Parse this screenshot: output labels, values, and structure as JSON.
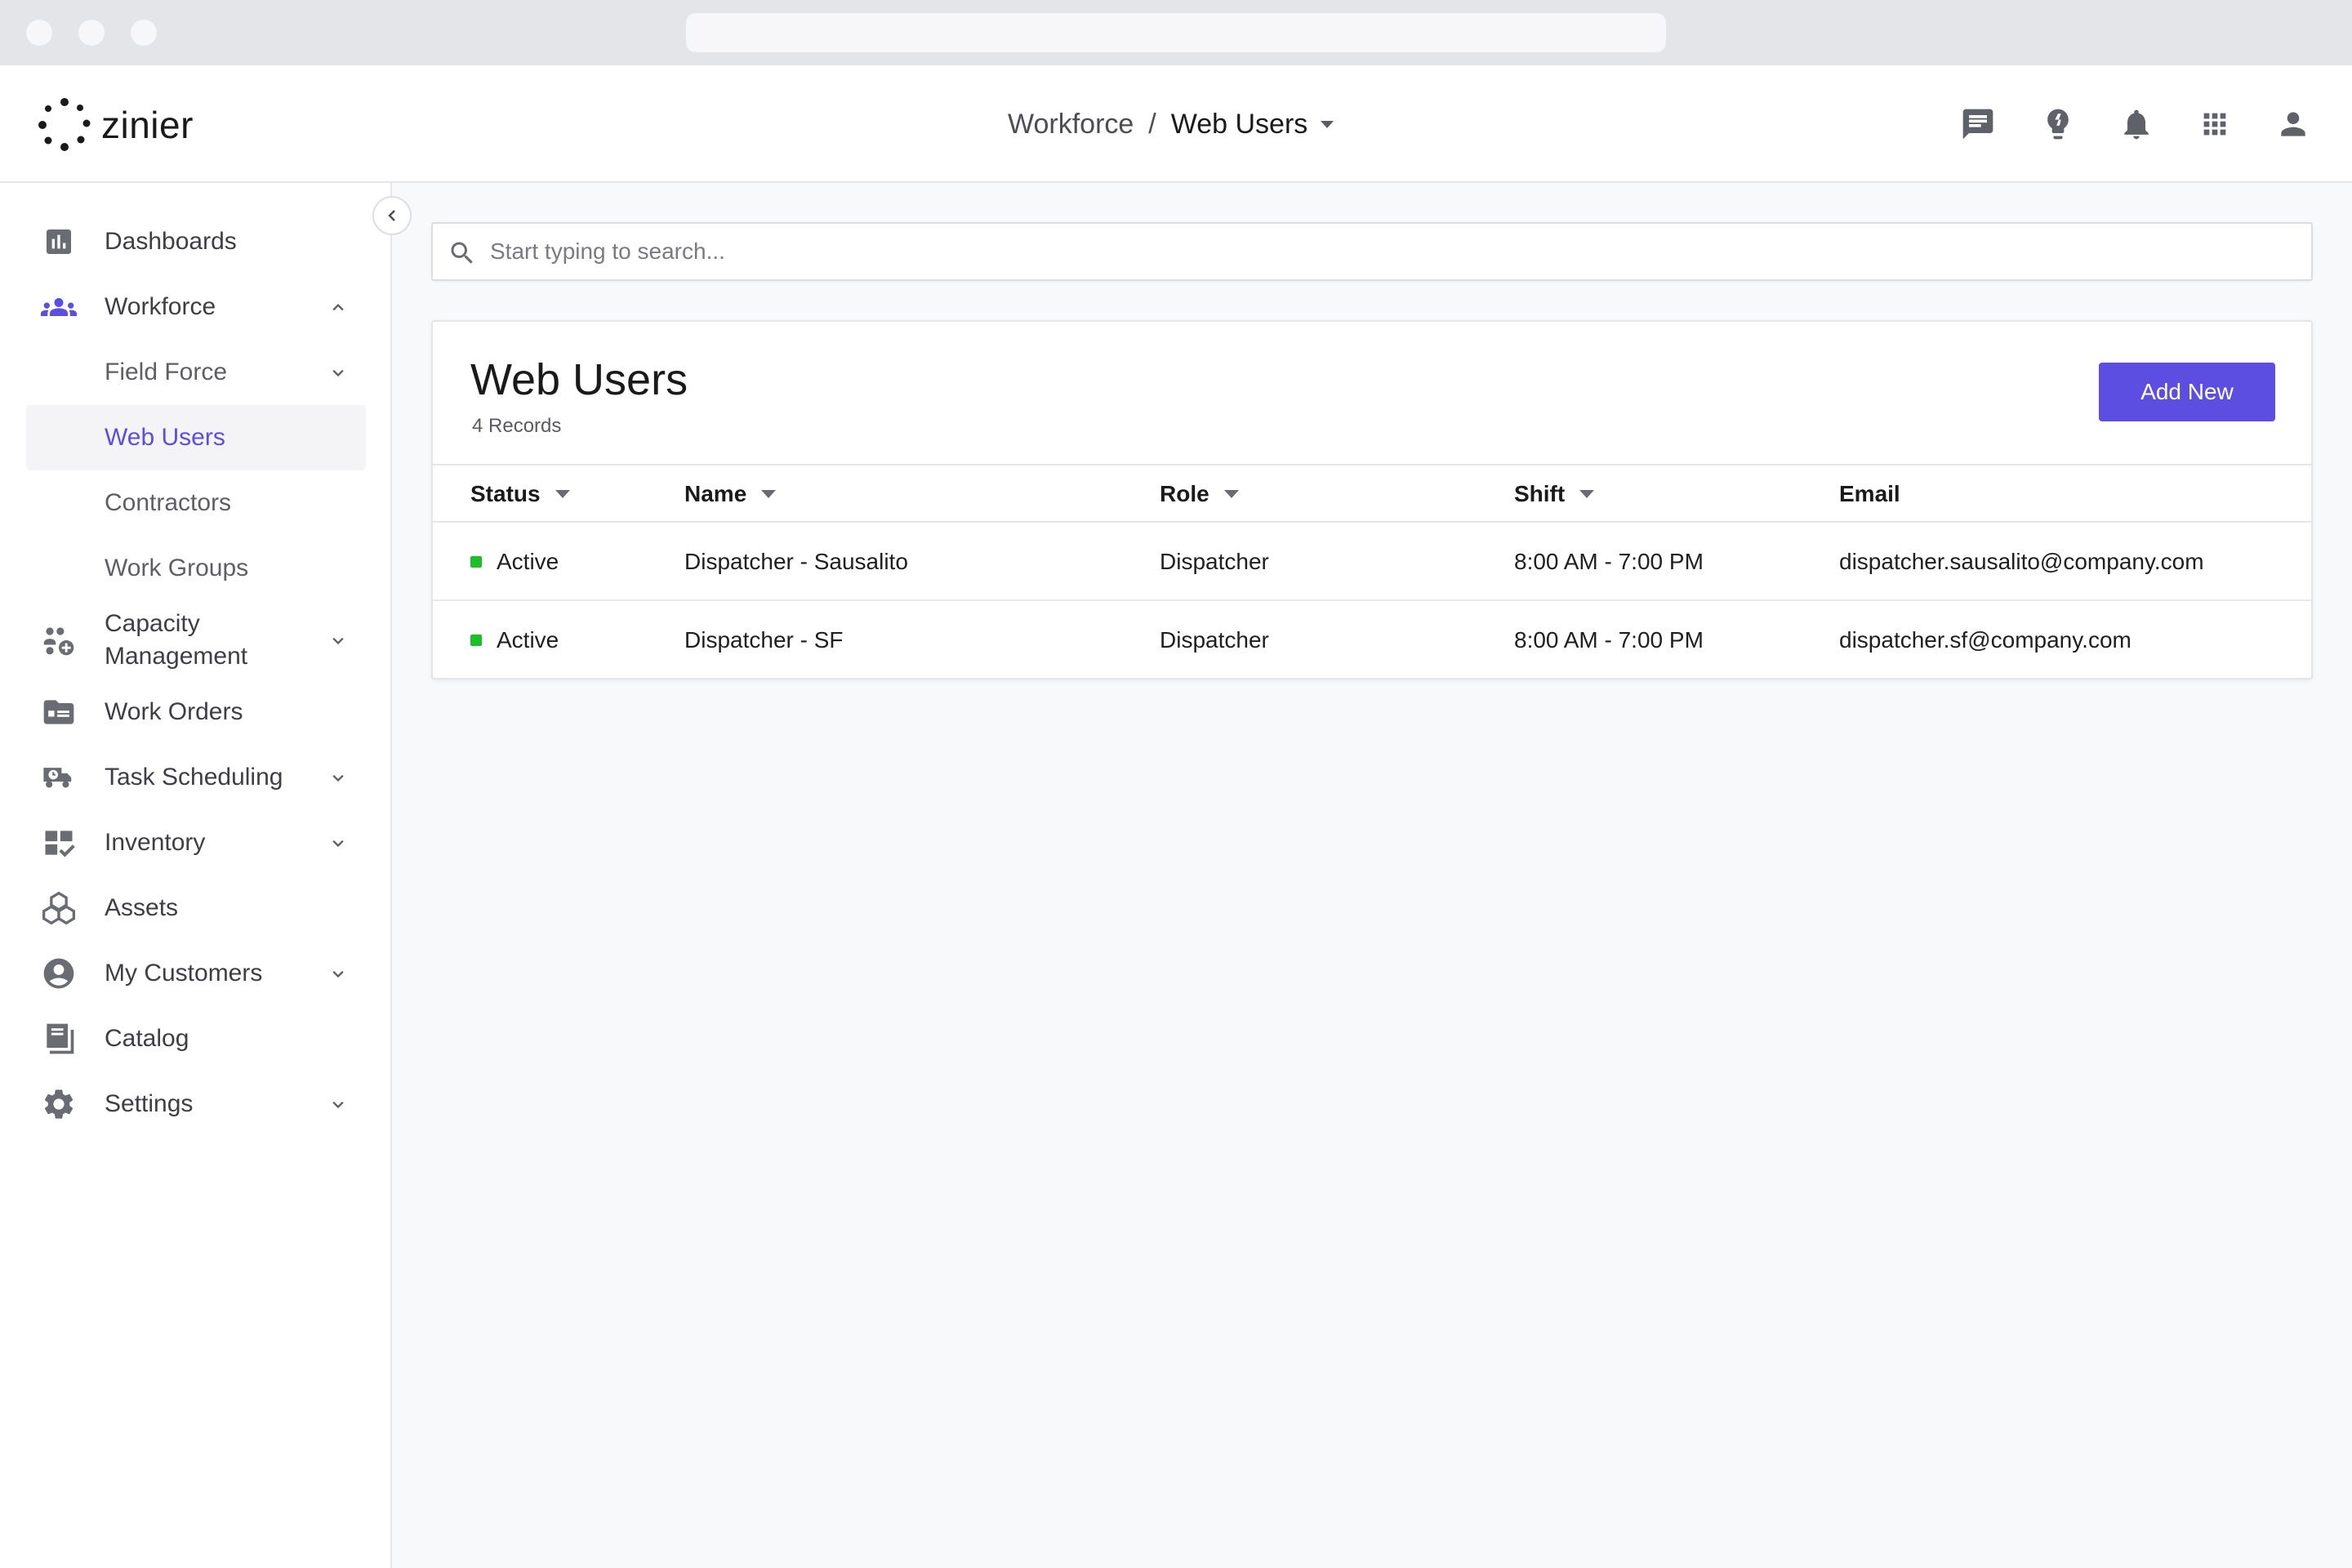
{
  "app": {
    "brand": "zinier",
    "status_color": "#1bbf2a",
    "accent_color": "#5b4ee0"
  },
  "breadcrumb": {
    "parent": "Workforce",
    "separator": "/",
    "current": "Web Users"
  },
  "header_icons": [
    "chat-icon",
    "lightbulb-icon",
    "bell-icon",
    "apps-grid-icon",
    "user-icon"
  ],
  "sidebar": {
    "items": [
      {
        "label": "Dashboards",
        "icon": "dashboard-icon"
      },
      {
        "label": "Workforce",
        "icon": "people-icon"
      },
      {
        "label": "Field Force"
      },
      {
        "label": "Web Users"
      },
      {
        "label": "Contractors"
      },
      {
        "label": "Work Groups"
      },
      {
        "label": "Capacity Management",
        "icon": "capacity-icon"
      },
      {
        "label": "Work Orders",
        "icon": "work-orders-icon"
      },
      {
        "label": "Task Scheduling",
        "icon": "truck-icon"
      },
      {
        "label": "Inventory",
        "icon": "inventory-icon"
      },
      {
        "label": "Assets",
        "icon": "assets-icon"
      },
      {
        "label": "My Customers",
        "icon": "customer-icon"
      },
      {
        "label": "Catalog",
        "icon": "catalog-icon"
      },
      {
        "label": "Settings",
        "icon": "settings-icon"
      }
    ]
  },
  "search": {
    "placeholder": "Start typing to search..."
  },
  "card": {
    "title": "Web Users",
    "subtitle": "4 Records",
    "add_label": "Add New"
  },
  "table": {
    "columns": [
      "Status",
      "Name",
      "Role",
      "Shift",
      "Email"
    ],
    "rows": [
      {
        "status": "Active",
        "name": "Dispatcher - Sausalito",
        "role": "Dispatcher",
        "shift": "8:00 AM - 7:00 PM",
        "email": "dispatcher.sausalito@company.com"
      },
      {
        "status": "Active",
        "name": "Dispatcher - SF",
        "role": "Dispatcher",
        "shift": "8:00 AM - 7:00 PM",
        "email": "dispatcher.sf@company.com"
      }
    ]
  }
}
